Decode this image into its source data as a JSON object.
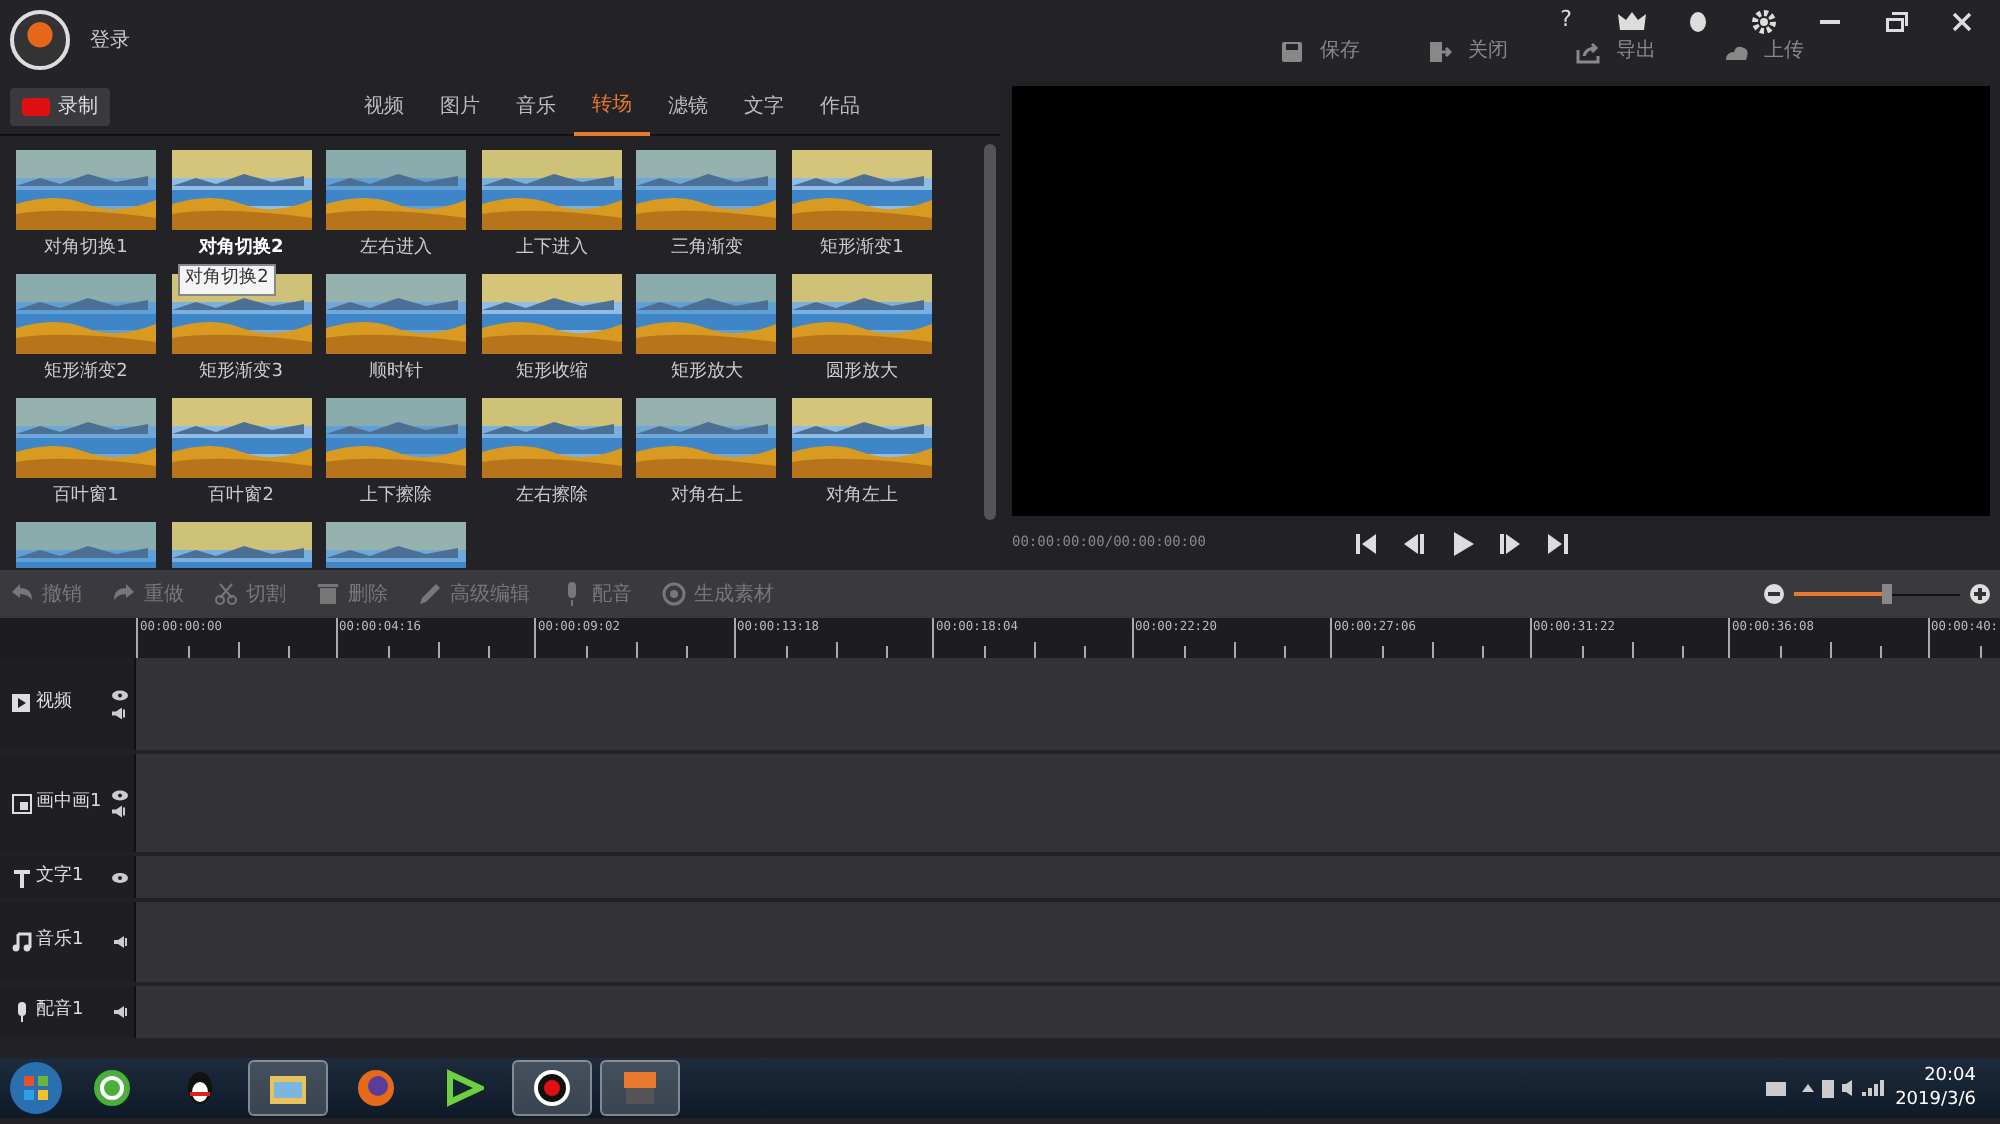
{
  "header": {
    "login": "登录",
    "window_buttons": [
      {
        "kind": "help",
        "label": "?"
      },
      {
        "kind": "vip"
      },
      {
        "kind": "qq"
      },
      {
        "kind": "settings"
      },
      {
        "kind": "minimize"
      },
      {
        "kind": "restore"
      },
      {
        "kind": "close"
      }
    ]
  },
  "actions": [
    {
      "kind": "save",
      "label": "保存"
    },
    {
      "kind": "exit",
      "label": "关闭"
    },
    {
      "kind": "export",
      "label": "导出"
    },
    {
      "kind": "upload",
      "label": "上传"
    }
  ],
  "record_button": "录制",
  "tabs": [
    {
      "label": "视频",
      "selected": false
    },
    {
      "label": "图片",
      "selected": false
    },
    {
      "label": "音乐",
      "selected": false
    },
    {
      "label": "转场",
      "selected": true
    },
    {
      "label": "滤镜",
      "selected": false
    },
    {
      "label": "文字",
      "selected": false
    },
    {
      "label": "作品",
      "selected": false
    }
  ],
  "transitions": [
    {
      "label": "对角切换1",
      "hovered": false
    },
    {
      "label": "对角切换2",
      "hovered": true
    },
    {
      "label": "左右进入",
      "hovered": false
    },
    {
      "label": "上下进入",
      "hovered": false
    },
    {
      "label": "三角渐变",
      "hovered": false
    },
    {
      "label": "矩形渐变1",
      "hovered": false
    },
    {
      "label": "矩形渐变2",
      "hovered": false
    },
    {
      "label": "矩形渐变3",
      "hovered": false
    },
    {
      "label": "顺时针",
      "hovered": false
    },
    {
      "label": "矩形收缩",
      "hovered": false
    },
    {
      "label": "矩形放大",
      "hovered": false
    },
    {
      "label": "圆形放大",
      "hovered": false
    },
    {
      "label": "百叶窗1",
      "hovered": false
    },
    {
      "label": "百叶窗2",
      "hovered": false
    },
    {
      "label": "上下擦除",
      "hovered": false
    },
    {
      "label": "左右擦除",
      "hovered": false
    },
    {
      "label": "对角右上",
      "hovered": false
    },
    {
      "label": "对角左上",
      "hovered": false
    },
    {
      "kind": "picture"
    },
    {
      "kind": "picture"
    },
    {
      "kind": "picture"
    }
  ],
  "tooltip": "对角切换2",
  "player": {
    "time": "00:00:00:00/00:00:00:00",
    "controls": [
      {
        "kind": "start"
      },
      {
        "kind": "prev"
      },
      {
        "kind": "play"
      },
      {
        "kind": "next"
      },
      {
        "kind": "end"
      }
    ]
  },
  "edit_tools": [
    {
      "kind": "undo",
      "label": "撤销"
    },
    {
      "kind": "redo",
      "label": "重做"
    },
    {
      "kind": "cut",
      "label": "切割"
    },
    {
      "kind": "delete",
      "label": "删除"
    },
    {
      "kind": "edit",
      "label": "高级编辑"
    },
    {
      "kind": "mic",
      "label": "配音"
    },
    {
      "kind": "generate",
      "label": "生成素材"
    }
  ],
  "zoom": {
    "level": 0.56
  },
  "ruler": [
    "00:00:00:00",
    "00:00:04:16",
    "00:00:09:02",
    "00:00:13:18",
    "00:00:18:04",
    "00:00:22:20",
    "00:00:27:06",
    "00:00:31:22",
    "00:00:36:08",
    "00:00:40:"
  ],
  "tracks": [
    {
      "kind": "video",
      "label": "视频",
      "eye": true,
      "sound": true
    },
    {
      "kind": "pip",
      "label": "画中画1",
      "eye": true,
      "sound": true
    },
    {
      "kind": "text",
      "label": "文字1",
      "eye": true,
      "sound": false
    },
    {
      "kind": "music",
      "label": "音乐1",
      "eye": false,
      "sound": true
    },
    {
      "kind": "voice",
      "label": "配音1",
      "eye": false,
      "sound": true
    }
  ],
  "taskbar": {
    "apps": [
      {
        "kind": "browser360",
        "active": false
      },
      {
        "kind": "qq",
        "active": false
      },
      {
        "kind": "folder",
        "active": true
      },
      {
        "kind": "firefox",
        "active": false
      },
      {
        "kind": "player",
        "active": false
      },
      {
        "kind": "record",
        "active": true
      },
      {
        "kind": "editor",
        "active": true
      }
    ],
    "time": "20:04",
    "date": "2019/3/6"
  }
}
